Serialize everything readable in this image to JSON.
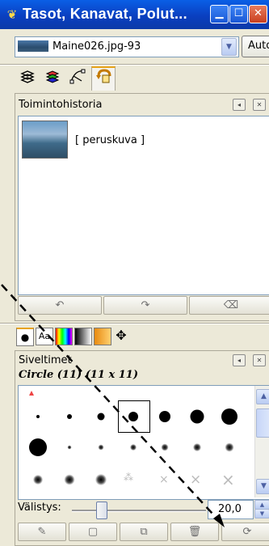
{
  "window": {
    "title": "Tasot, Kanavat, Polut...",
    "icon": "wilber-icon",
    "buttons": [
      "minimize",
      "maximize",
      "close"
    ]
  },
  "image_selector": {
    "value": "Maine026.jpg-93",
    "auto_label": "Auto"
  },
  "dock_tabs": [
    "layers-icon",
    "channels-icon",
    "paths-icon",
    "undo-history-icon"
  ],
  "history": {
    "title": "Toimintohistoria",
    "items": [
      {
        "label": "[ peruskuva ]"
      }
    ],
    "buttons": [
      "undo-icon",
      "redo-icon",
      "clear-history-icon"
    ]
  },
  "tool_tabs": [
    "brush-icon",
    "font-icon",
    "pattern-icon",
    "gradient-icon",
    "color-icon",
    "move-icon"
  ],
  "tool_tab_font_label": "Aa",
  "brushes": {
    "title": "Siveltimet",
    "selected": "Circle (11) (11 x 11)",
    "spacing_label": "Välistys:",
    "spacing_value": "20,0",
    "spacing_fraction": 0.2,
    "buttons": [
      "edit-brush-icon",
      "new-brush-icon",
      "duplicate-brush-icon",
      "delete-brush-icon",
      "refresh-brushes-icon"
    ]
  },
  "colors": {
    "titlebar": "#0a4fd6",
    "background": "#ece9d8",
    "active_tab_marker": "#e8a318"
  }
}
